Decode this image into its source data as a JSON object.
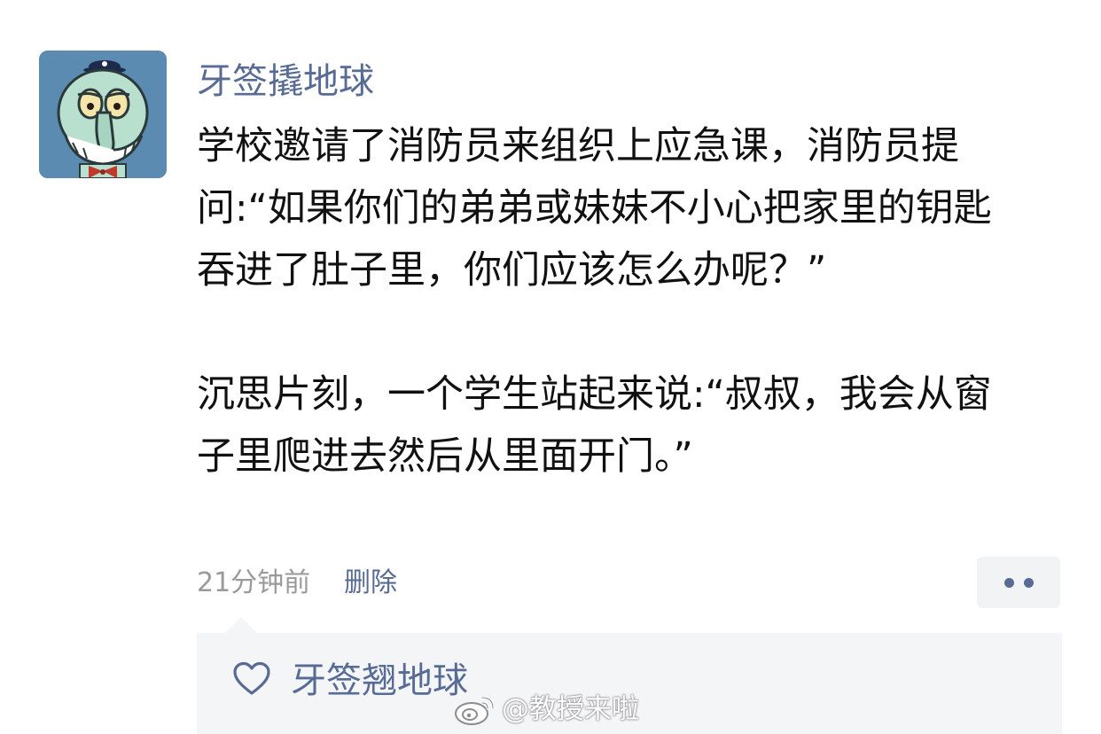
{
  "post": {
    "author_name": "牙签撬地球",
    "paragraphs": [
      "学校邀请了消防员来组织上应急课，消防员提问:“如果你们的弟弟或妹妹不小心把家里的钥匙吞进了肚子里，你们应该怎么办呢？”",
      "沉思片刻，一个学生站起来说:“叔叔，我会从窗子里爬进去然后从里面开门。”"
    ],
    "timestamp": "21分钟前",
    "delete_label": "删除"
  },
  "likes": {
    "icon": "heart-outline-icon",
    "names": "牙签翘地球"
  },
  "watermark": {
    "icon": "weibo-logo-icon",
    "text": "@教授来啦"
  },
  "colors": {
    "link_blue": "#576b95",
    "body_text": "#111111",
    "meta_gray": "#9a9a9a",
    "likes_bg": "#f4f5f7",
    "avatar_bg": "#5b8bb0"
  }
}
